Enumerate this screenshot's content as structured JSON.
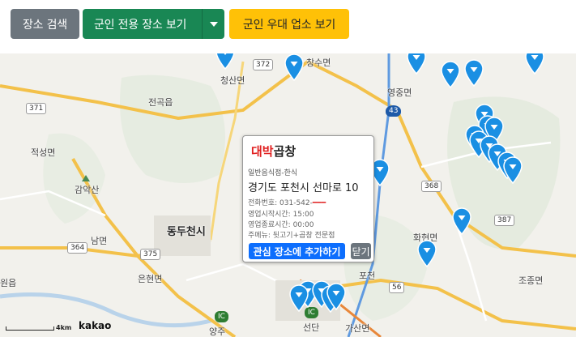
{
  "toolbar": {
    "search_label": "장소 검색",
    "military_label": "군인 전용 장소 보기",
    "discount_label": "군인 우대 업소 보기"
  },
  "map": {
    "place_labels": [
      "청산면",
      "영중면",
      "전곡읍",
      "적성면",
      "감악산",
      "동두천시",
      "남면",
      "은현면",
      "화현면",
      "조종면",
      "포천",
      "선단",
      "가산면",
      "양주",
      "원읍",
      "창수면"
    ],
    "road_numbers": [
      "372",
      "371",
      "43",
      "368",
      "387",
      "364",
      "375",
      "56",
      "IC"
    ],
    "scale_label": "4km",
    "logo": "kakao"
  },
  "popup": {
    "name_redacted": "대박",
    "name_suffix": "곱창",
    "category": "일반음식점-한식",
    "address": "경기도 포천시 선마로 10",
    "phone": "전화번호: 031-542-",
    "open_time": "영업시작시간: 15:00",
    "close_time": "영업종료시간: 00:00",
    "menu": "주메뉴: 뒷고기+곱창 전문점",
    "add_button": "관심 장소에 추가하기",
    "close_button": "닫기"
  },
  "colors": {
    "pin": "#1a8fe3",
    "accent_blue": "#0d6efd",
    "green": "#198754",
    "yellow": "#ffc107",
    "gray": "#6c757d"
  }
}
